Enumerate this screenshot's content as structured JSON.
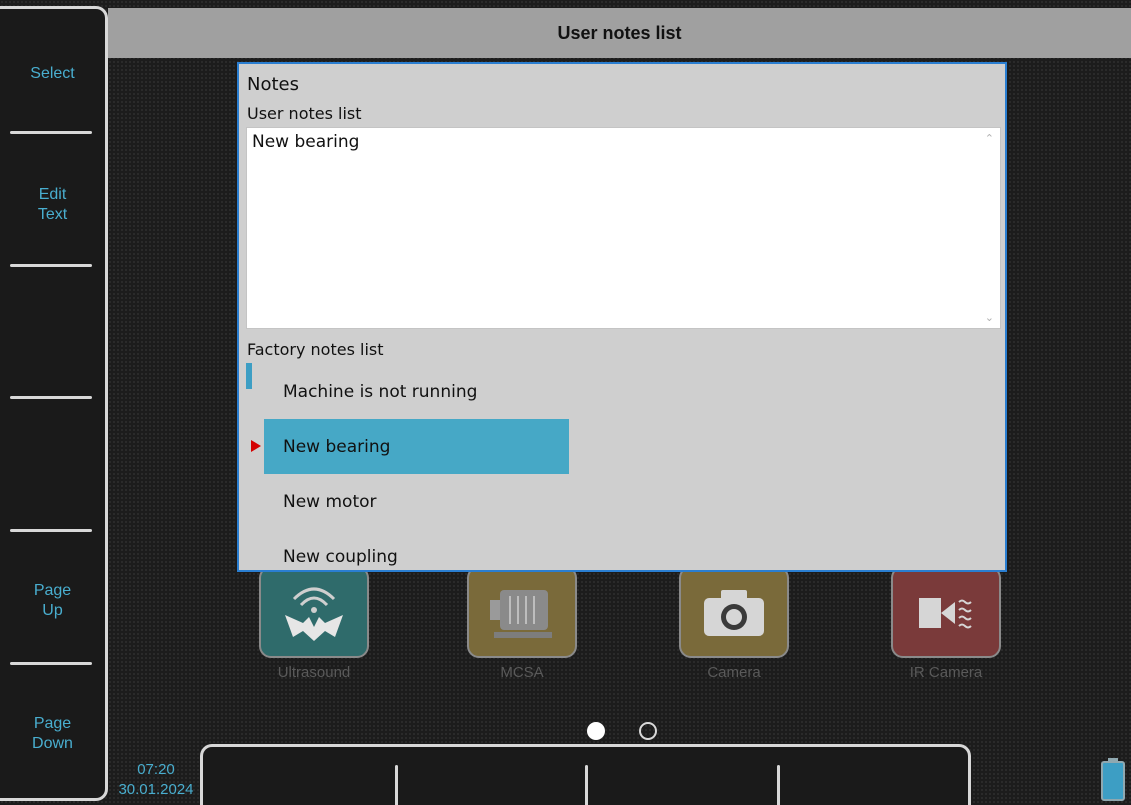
{
  "title": "User notes list",
  "softkeys": [
    {
      "label": "Select"
    },
    {
      "label": "Edit\nText"
    },
    {
      "label": ""
    },
    {
      "label": ""
    },
    {
      "label": "Page\nUp"
    },
    {
      "label": "Page\nDown"
    }
  ],
  "dialog": {
    "title": "Notes",
    "user_notes_label": "User notes list",
    "user_notes_value": "New bearing",
    "factory_notes_label": "Factory notes list",
    "factory_notes": [
      {
        "label": "Machine is not running",
        "selected": false
      },
      {
        "label": "New bearing",
        "selected": true
      },
      {
        "label": "New motor",
        "selected": false
      },
      {
        "label": "New coupling",
        "selected": false
      }
    ]
  },
  "apps": [
    {
      "label": "Ultrasound",
      "icon": "ultrasound-bat-icon",
      "color": "#2f6b6b"
    },
    {
      "label": "MCSA",
      "icon": "motor-icon",
      "color": "#7a6a3a"
    },
    {
      "label": "Camera",
      "icon": "camera-icon",
      "color": "#7a6a3a"
    },
    {
      "label": "IR Camera",
      "icon": "ir-camera-icon",
      "color": "#7a3a3a"
    }
  ],
  "pagination": {
    "pages": 2,
    "current": 1
  },
  "status": {
    "time": "07:20",
    "date": "30.01.2024"
  },
  "colors": {
    "accent": "#49aecf",
    "selection": "#46a8c6",
    "dialog_border": "#2a7ed1",
    "marker": "#d40000"
  }
}
